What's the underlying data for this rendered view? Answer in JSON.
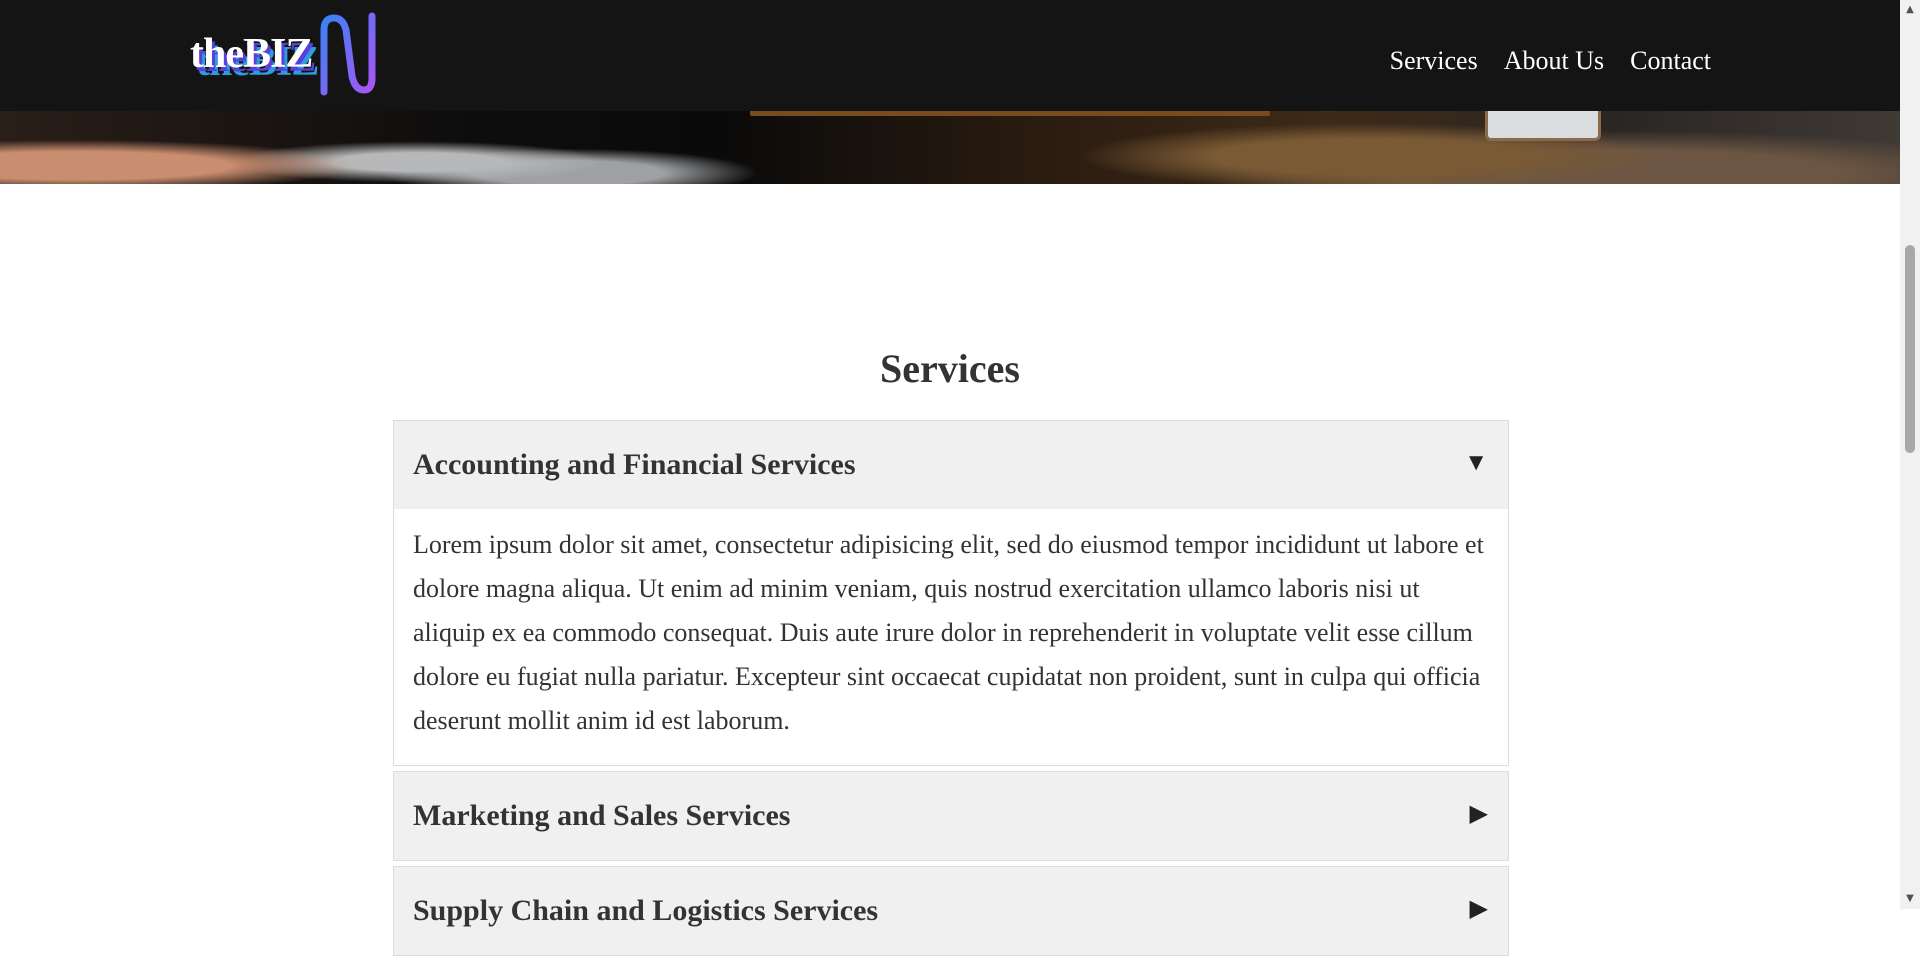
{
  "header": {
    "logo_text": "theBIZ",
    "nav": [
      {
        "label": "Services"
      },
      {
        "label": "About Us"
      },
      {
        "label": "Contact"
      }
    ]
  },
  "main": {
    "title": "Services",
    "accordion": [
      {
        "title": "Accounting and Financial Services",
        "expanded": true,
        "arrow": "▼",
        "body": "Lorem ipsum dolor sit amet, consectetur adipisicing elit, sed do eiusmod tempor incididunt ut labore et dolore magna aliqua. Ut enim ad minim veniam, quis nostrud exercitation ullamco laboris nisi ut aliquip ex ea commodo consequat. Duis aute irure dolor in reprehenderit in voluptate velit esse cillum dolore eu fugiat nulla pariatur. Excepteur sint occaecat cupidatat non proident, sunt in culpa qui officia deserunt mollit anim id est laborum."
      },
      {
        "title": "Marketing and Sales Services",
        "expanded": false,
        "arrow": "▶"
      },
      {
        "title": "Supply Chain and Logistics Services",
        "expanded": false,
        "arrow": "▶"
      }
    ]
  },
  "scrollbar": {
    "up_arrow": "▲",
    "down_arrow": "▼"
  },
  "colors": {
    "header_bg": "#141414",
    "accordion_head_bg": "#f0f0f0",
    "text": "#333333",
    "logo_gradient_start": "#3b82f6",
    "logo_gradient_end": "#a855f7"
  }
}
